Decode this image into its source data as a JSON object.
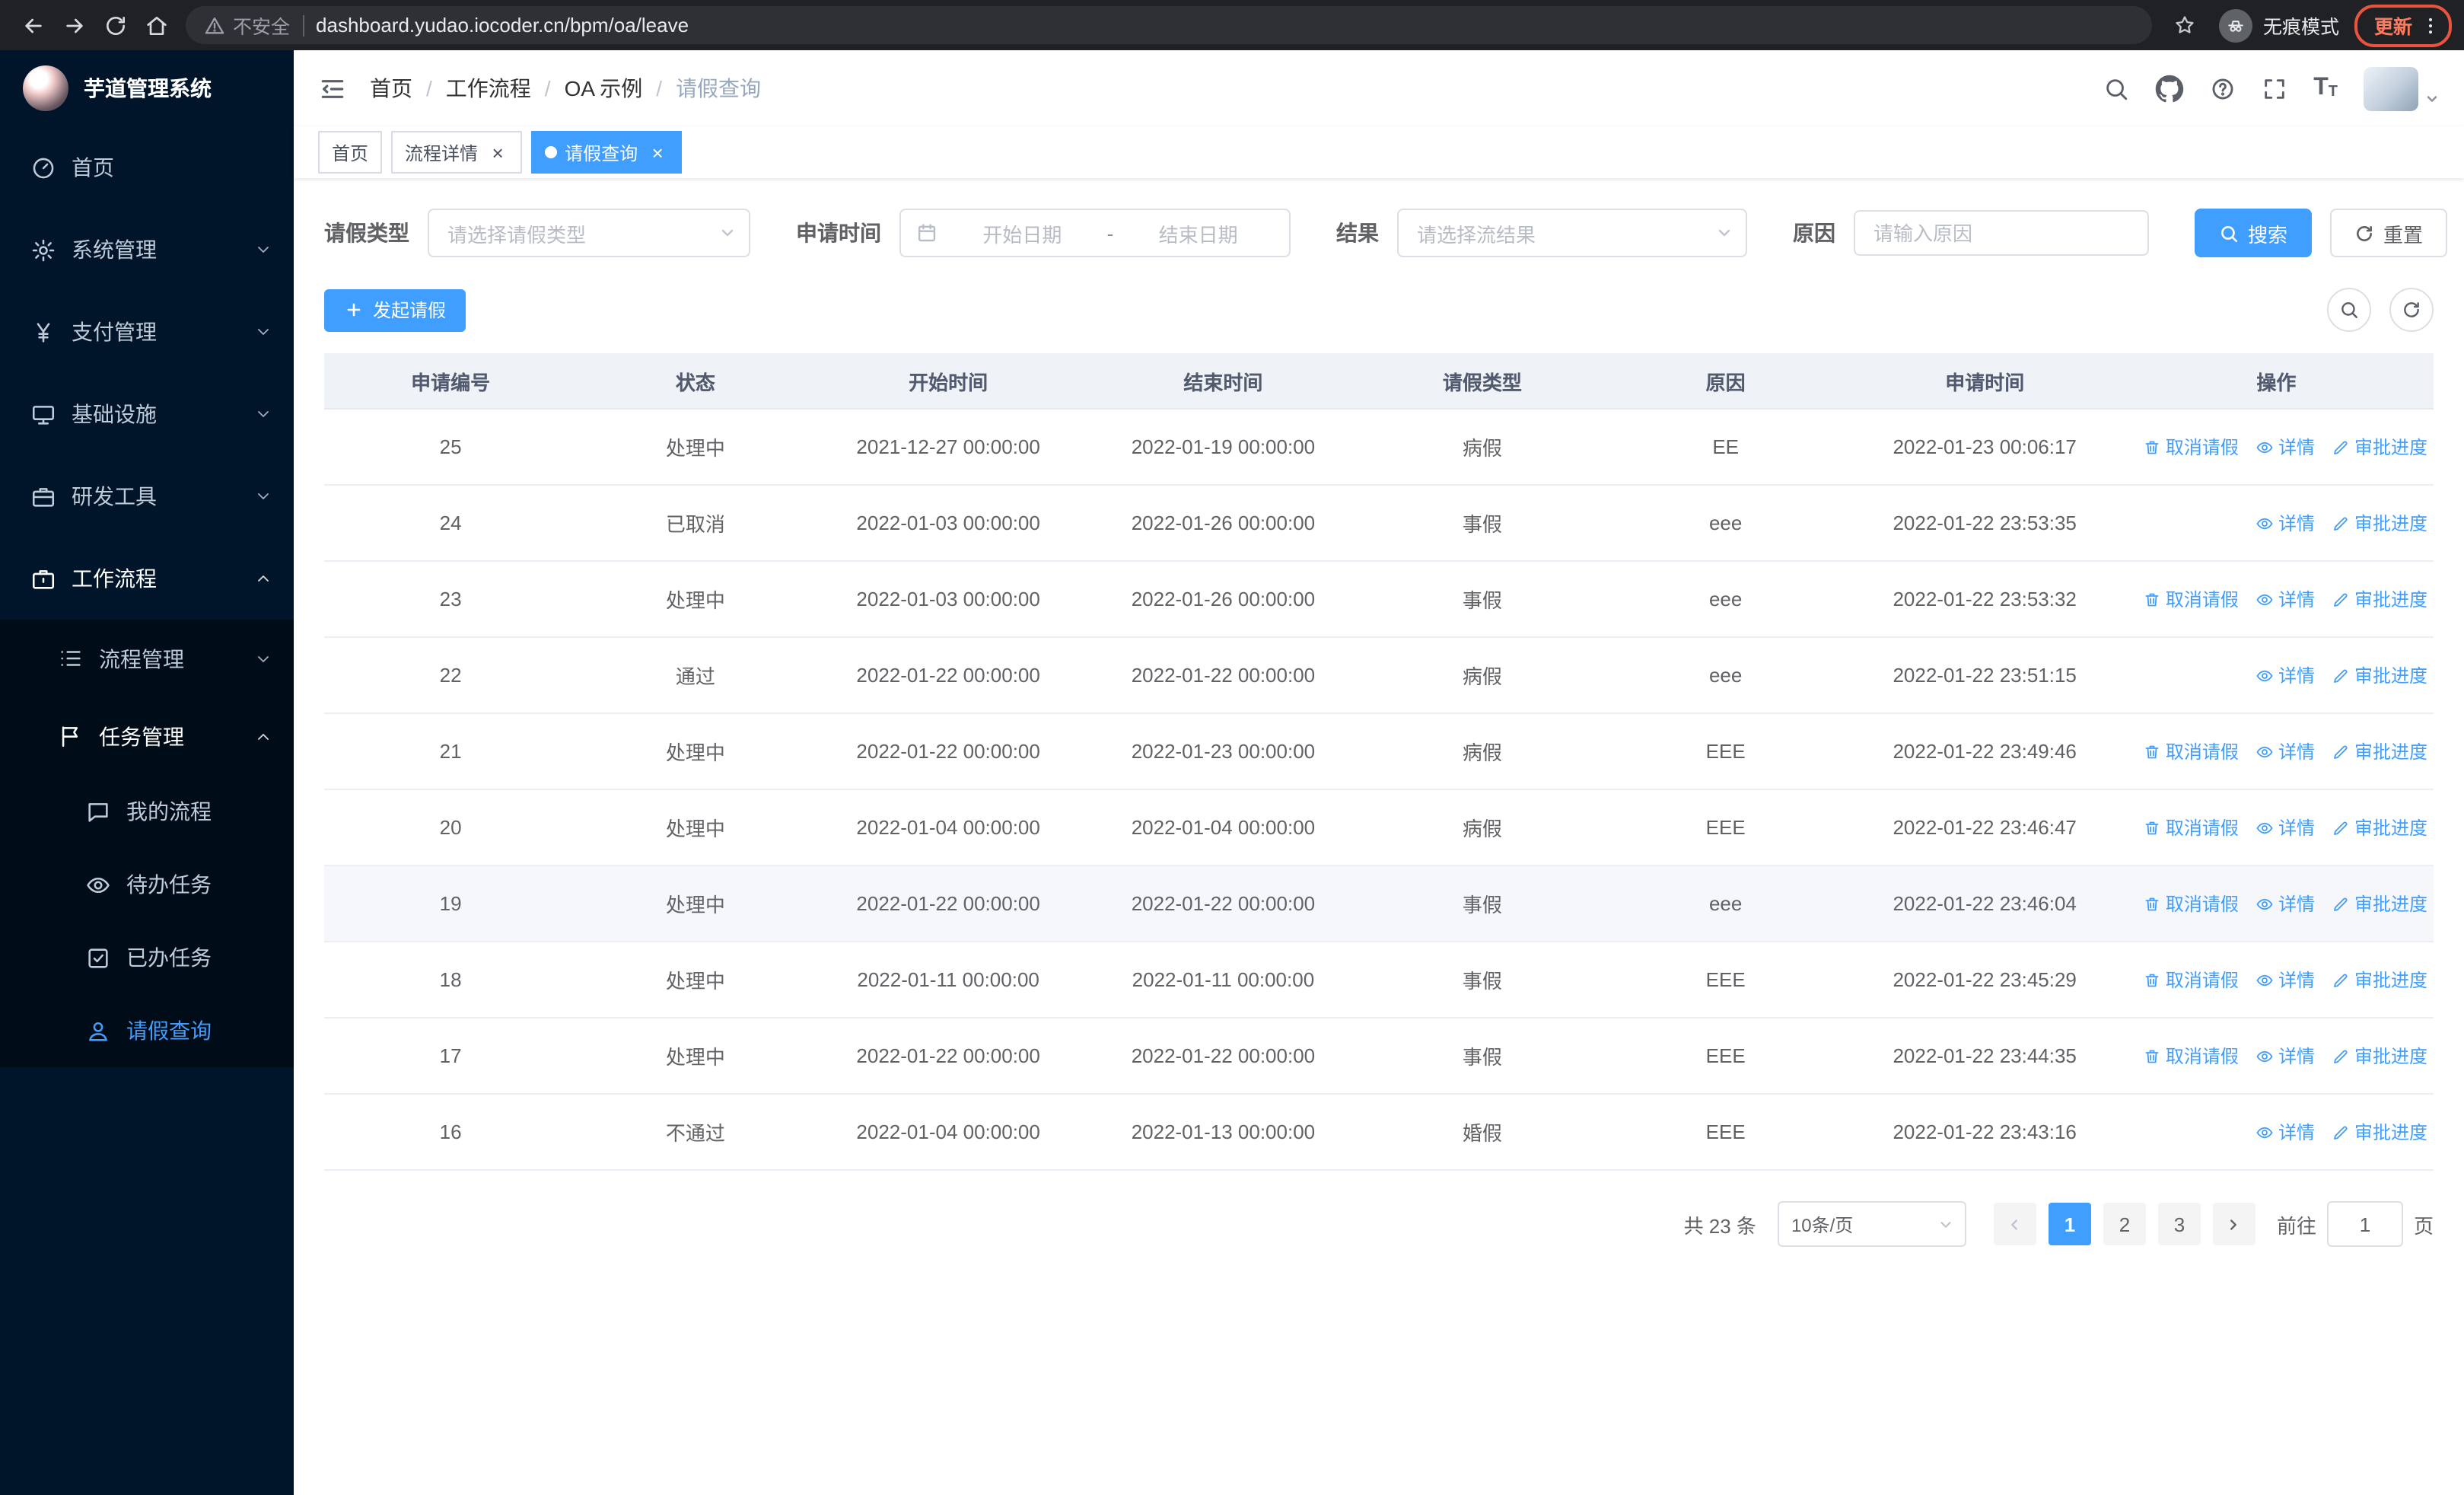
{
  "theme": {
    "accent": "#409eff",
    "sidebar_bg": "#001529",
    "sidebar_submenu_bg": "#000c17",
    "active_tab_bg": "#409eff",
    "update_chip_color": "#e8543f"
  },
  "browser": {
    "security_label": "不安全",
    "url": "dashboard.yudao.iocoder.cn/bpm/oa/leave",
    "incognito_label": "无痕模式",
    "update_label": "更新"
  },
  "sidebar": {
    "app_title": "芋道管理系统",
    "menu": [
      {
        "name": "home",
        "label": "首页",
        "icon": "dashboard-icon",
        "level": 1,
        "chevron": null,
        "active": false,
        "trail": false
      },
      {
        "name": "system-management",
        "label": "系统管理",
        "icon": "gear-icon",
        "level": 1,
        "chevron": "down",
        "active": false,
        "trail": false
      },
      {
        "name": "payment-management",
        "label": "支付管理",
        "icon": "payment-icon",
        "level": 1,
        "chevron": "down",
        "active": false,
        "trail": false
      },
      {
        "name": "infrastructure",
        "label": "基础设施",
        "icon": "infrastructure-icon",
        "level": 1,
        "chevron": "down",
        "active": false,
        "trail": false
      },
      {
        "name": "dev-tools",
        "label": "研发工具",
        "icon": "devtools-icon",
        "level": 1,
        "chevron": "down",
        "active": false,
        "trail": false
      },
      {
        "name": "workflow",
        "label": "工作流程",
        "icon": "workflow-icon",
        "level": 1,
        "chevron": "up",
        "active": false,
        "trail": true
      },
      {
        "name": "process-management",
        "label": "流程管理",
        "icon": "process-icon",
        "level": 2,
        "chevron": "down",
        "active": false,
        "trail": false
      },
      {
        "name": "task-management",
        "label": "任务管理",
        "icon": "task-icon",
        "level": 2,
        "chevron": "up",
        "active": false,
        "trail": true
      },
      {
        "name": "my-process",
        "label": "我的流程",
        "icon": "my-process-icon",
        "level": 3,
        "chevron": null,
        "active": false,
        "trail": false
      },
      {
        "name": "todo-tasks",
        "label": "待办任务",
        "icon": "todo-icon",
        "level": 3,
        "chevron": null,
        "active": false,
        "trail": false
      },
      {
        "name": "done-tasks",
        "label": "已办任务",
        "icon": "done-icon",
        "level": 3,
        "chevron": null,
        "active": false,
        "trail": false
      },
      {
        "name": "leave-query",
        "label": "请假查询",
        "icon": "leave-icon",
        "level": 3,
        "chevron": null,
        "active": true,
        "trail": false
      }
    ]
  },
  "header": {
    "breadcrumb": [
      {
        "label": "首页",
        "current": false
      },
      {
        "label": "工作流程",
        "current": false
      },
      {
        "label": "OA 示例",
        "current": false
      },
      {
        "label": "请假查询",
        "current": true
      }
    ]
  },
  "tabs": [
    {
      "name": "home",
      "label": "首页",
      "closable": false,
      "active": false
    },
    {
      "name": "process-detail",
      "label": "流程详情",
      "closable": true,
      "active": false
    },
    {
      "name": "leave-query",
      "label": "请假查询",
      "closable": true,
      "active": true
    }
  ],
  "filters": {
    "leave_type_label": "请假类型",
    "leave_type_placeholder": "请选择请假类型",
    "apply_time_label": "申请时间",
    "start_date_placeholder": "开始日期",
    "range_separator": "-",
    "end_date_placeholder": "结束日期",
    "result_label": "结果",
    "result_placeholder": "请选择流结果",
    "reason_label": "原因",
    "reason_placeholder": "请输入原因",
    "search_button": "搜索",
    "reset_button": "重置"
  },
  "toolbar": {
    "create_label": "发起请假"
  },
  "table": {
    "columns": [
      "申请编号",
      "状态",
      "开始时间",
      "结束时间",
      "请假类型",
      "原因",
      "申请时间",
      "操作"
    ],
    "action_labels": {
      "cancel": "取消请假",
      "detail": "详情",
      "progress": "审批进度"
    },
    "rows": [
      {
        "id": "25",
        "status": "处理中",
        "start_time": "2021-12-27 00:00:00",
        "end_time": "2022-01-19 00:00:00",
        "leave_type": "病假",
        "reason": "EE",
        "apply_time": "2022-01-23 00:06:17",
        "can_cancel": true,
        "highlight": false
      },
      {
        "id": "24",
        "status": "已取消",
        "start_time": "2022-01-03 00:00:00",
        "end_time": "2022-01-26 00:00:00",
        "leave_type": "事假",
        "reason": "eee",
        "apply_time": "2022-01-22 23:53:35",
        "can_cancel": false,
        "highlight": false
      },
      {
        "id": "23",
        "status": "处理中",
        "start_time": "2022-01-03 00:00:00",
        "end_time": "2022-01-26 00:00:00",
        "leave_type": "事假",
        "reason": "eee",
        "apply_time": "2022-01-22 23:53:32",
        "can_cancel": true,
        "highlight": false
      },
      {
        "id": "22",
        "status": "通过",
        "start_time": "2022-01-22 00:00:00",
        "end_time": "2022-01-22 00:00:00",
        "leave_type": "病假",
        "reason": "eee",
        "apply_time": "2022-01-22 23:51:15",
        "can_cancel": false,
        "highlight": false
      },
      {
        "id": "21",
        "status": "处理中",
        "start_time": "2022-01-22 00:00:00",
        "end_time": "2022-01-23 00:00:00",
        "leave_type": "病假",
        "reason": "EEE",
        "apply_time": "2022-01-22 23:49:46",
        "can_cancel": true,
        "highlight": false
      },
      {
        "id": "20",
        "status": "处理中",
        "start_time": "2022-01-04 00:00:00",
        "end_time": "2022-01-04 00:00:00",
        "leave_type": "病假",
        "reason": "EEE",
        "apply_time": "2022-01-22 23:46:47",
        "can_cancel": true,
        "highlight": false
      },
      {
        "id": "19",
        "status": "处理中",
        "start_time": "2022-01-22 00:00:00",
        "end_time": "2022-01-22 00:00:00",
        "leave_type": "事假",
        "reason": "eee",
        "apply_time": "2022-01-22 23:46:04",
        "can_cancel": true,
        "highlight": true
      },
      {
        "id": "18",
        "status": "处理中",
        "start_time": "2022-01-11 00:00:00",
        "end_time": "2022-01-11 00:00:00",
        "leave_type": "事假",
        "reason": "EEE",
        "apply_time": "2022-01-22 23:45:29",
        "can_cancel": true,
        "highlight": false
      },
      {
        "id": "17",
        "status": "处理中",
        "start_time": "2022-01-22 00:00:00",
        "end_time": "2022-01-22 00:00:00",
        "leave_type": "事假",
        "reason": "EEE",
        "apply_time": "2022-01-22 23:44:35",
        "can_cancel": true,
        "highlight": false
      },
      {
        "id": "16",
        "status": "不通过",
        "start_time": "2022-01-04 00:00:00",
        "end_time": "2022-01-13 00:00:00",
        "leave_type": "婚假",
        "reason": "EEE",
        "apply_time": "2022-01-22 23:43:16",
        "can_cancel": false,
        "highlight": false
      }
    ]
  },
  "pagination": {
    "total_label": "共 23 条",
    "page_size": "10条/页",
    "pages": [
      "1",
      "2",
      "3"
    ],
    "active_page": "1",
    "goto_prefix": "前往",
    "goto_value": "1",
    "goto_suffix": "页"
  }
}
